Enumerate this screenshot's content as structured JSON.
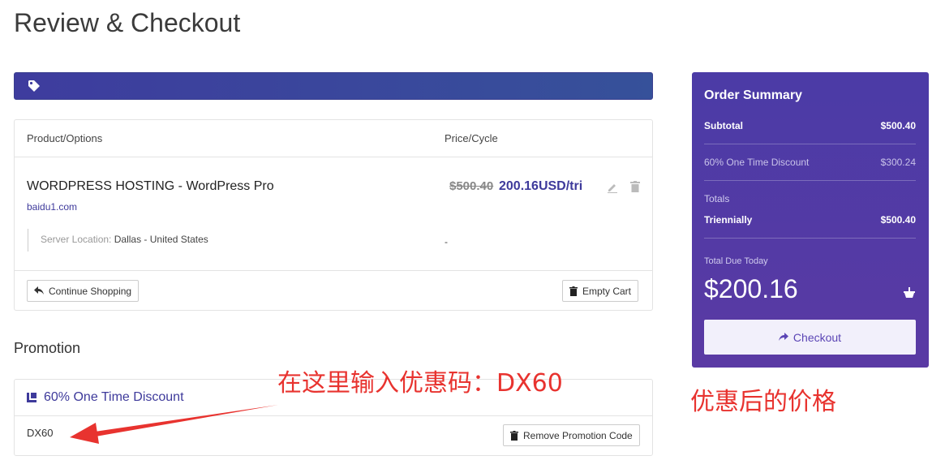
{
  "page": {
    "title": "Review & Checkout"
  },
  "cart": {
    "col_product": "Product/Options",
    "col_price": "Price/Cycle",
    "item": {
      "name": "WORDPRESS HOSTING - WordPress Pro",
      "domain": "baidu1.com",
      "old_price": "$500.40",
      "new_price": "200.16USD/tri",
      "option_label": "Server Location:",
      "option_value": "Dallas - United States",
      "option_price": "-"
    },
    "continue_label": "Continue Shopping",
    "empty_label": "Empty Cart"
  },
  "promotion": {
    "heading": "Promotion",
    "name": "60% One Time Discount",
    "code": "DX60",
    "remove_label": "Remove Promotion Code"
  },
  "summary": {
    "heading": "Order Summary",
    "subtotal_label": "Subtotal",
    "subtotal_value": "$500.40",
    "discount_label": "60% One Time Discount",
    "discount_value": "$300.24",
    "totals_label": "Totals",
    "cycle_label": "Triennially",
    "cycle_value": "$500.40",
    "due_label": "Total Due Today",
    "due_value": "$200.16",
    "checkout_label": "Checkout"
  },
  "annotations": {
    "promo_hint": "在这里输入优惠码：DX60",
    "price_hint": "优惠后的价格"
  },
  "colors": {
    "accent": "#3e3a9b",
    "summary_bg": "#503aa5",
    "annotation": "#e8332f"
  }
}
